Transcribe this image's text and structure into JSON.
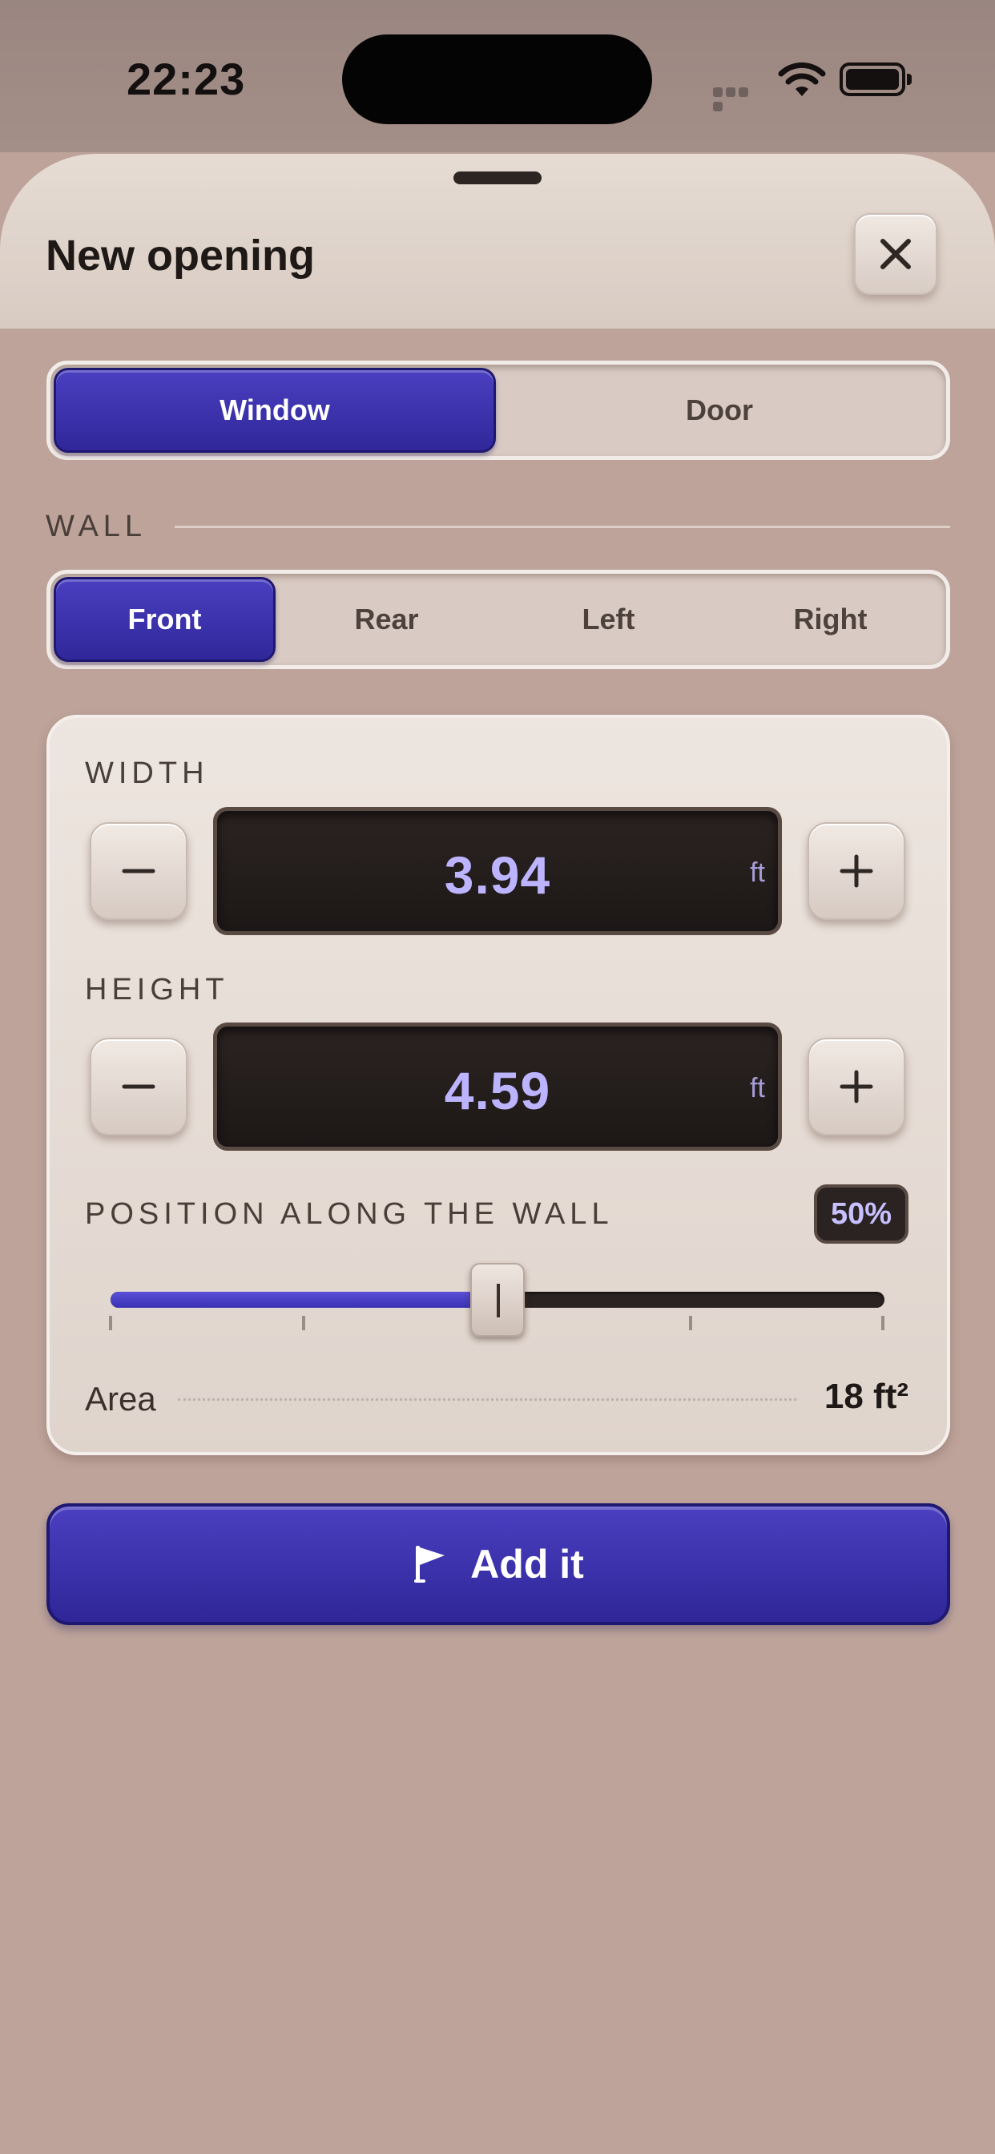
{
  "status_bar": {
    "time": "22:23"
  },
  "sheet": {
    "title": "New opening",
    "close_label": "close"
  },
  "opening_type": {
    "options": [
      {
        "label": "Window",
        "selected": true
      },
      {
        "label": "Door",
        "selected": false
      }
    ]
  },
  "wall": {
    "label": "WALL",
    "options": [
      {
        "label": "Front",
        "selected": true
      },
      {
        "label": "Rear",
        "selected": false
      },
      {
        "label": "Left",
        "selected": false
      },
      {
        "label": "Right",
        "selected": false
      }
    ]
  },
  "width": {
    "label": "WIDTH",
    "value": "3.94",
    "unit": "ft"
  },
  "height": {
    "label": "HEIGHT",
    "value": "4.59",
    "unit": "ft"
  },
  "position": {
    "label": "POSITION ALONG THE WALL",
    "value_text": "50%",
    "value": 0.5
  },
  "area": {
    "label": "Area",
    "value": "18 ft²"
  },
  "add_button": {
    "label": "Add it",
    "icon": "flag-icon"
  },
  "colors": {
    "accent": "#3d33b0",
    "display_bg": "#231d1b",
    "display_text": "#bdb4ff",
    "background": "#bda39a"
  }
}
